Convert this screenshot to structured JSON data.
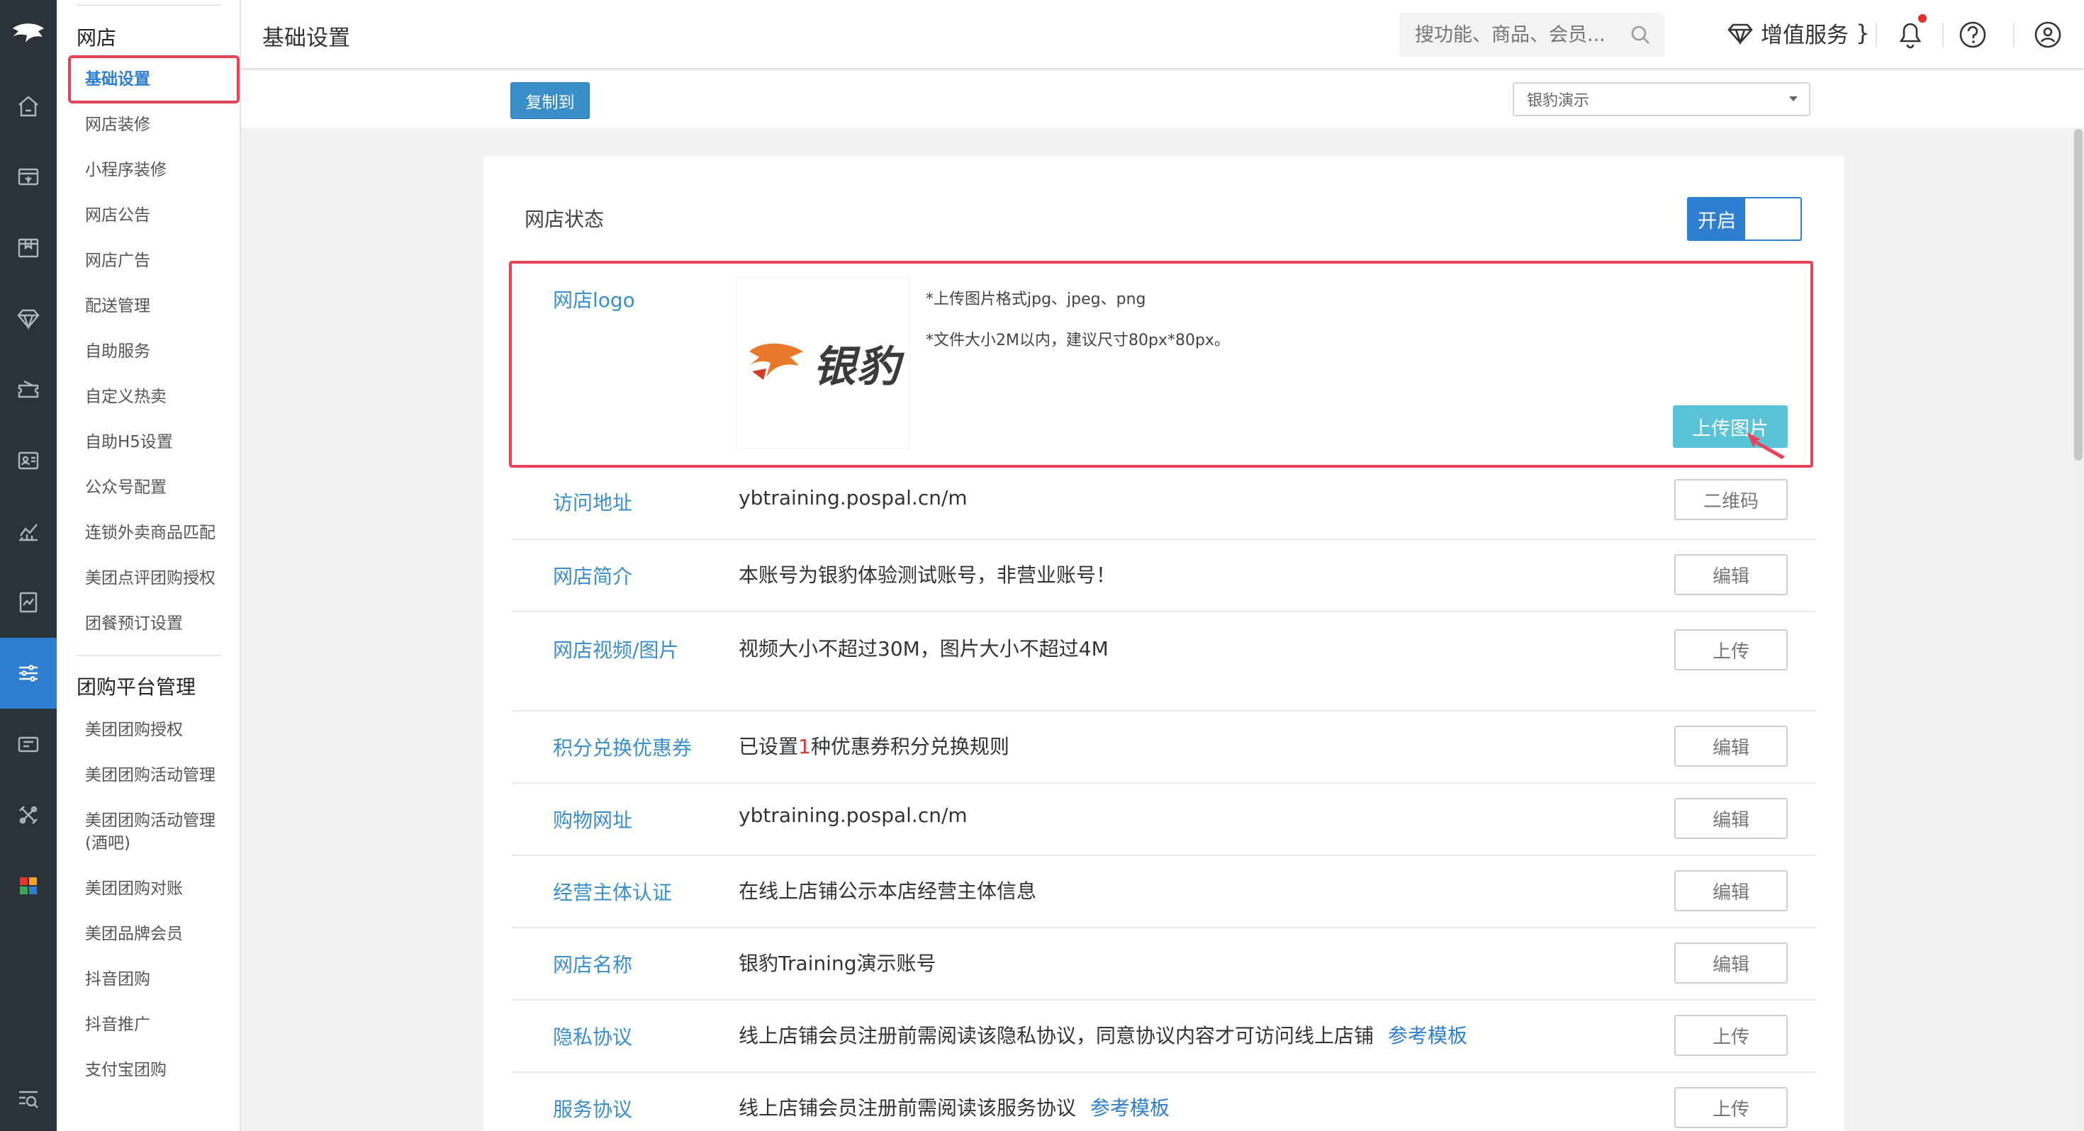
{
  "rail": {
    "logo_icon": "panther-logo-icon",
    "items": [
      {
        "icon": "home-icon"
      },
      {
        "icon": "cashier-icon"
      },
      {
        "icon": "box-icon"
      },
      {
        "icon": "diamond-icon"
      },
      {
        "icon": "ticket-icon"
      },
      {
        "icon": "member-card-icon"
      },
      {
        "icon": "chart-icon"
      },
      {
        "icon": "report-icon"
      },
      {
        "icon": "settings-sliders-icon",
        "active": true
      },
      {
        "icon": "coupon-icon"
      },
      {
        "icon": "tools-icon"
      },
      {
        "icon": "apps-grid-icon"
      },
      {
        "icon": "search-list-icon"
      }
    ]
  },
  "subnav": {
    "group1": "网店",
    "group1_items": [
      "基础设置",
      "网店装修",
      "小程序装修",
      "网店公告",
      "网店广告",
      "配送管理",
      "自助服务",
      "自定义热卖",
      "自助H5设置",
      "公众号配置",
      "连锁外卖商品匹配",
      "美团点评团购授权",
      "团餐预订设置"
    ],
    "group2": "团购平台管理",
    "group2_items": [
      "美团团购授权",
      "美团团购活动管理",
      "美团团购活动管理",
      "(酒吧)",
      "美团团购对账",
      "美团品牌会员",
      "抖音团购",
      "抖音推广",
      "支付宝团购"
    ]
  },
  "header": {
    "title": "基础设置",
    "search_placeholder": "搜功能、商品、会员...",
    "value_added": "增值服务"
  },
  "toolbar": {
    "copy_label": "复制到",
    "store_selected": "银豹演示"
  },
  "card": {
    "status_label": "网店状态",
    "toggle_on": "开启",
    "logo": {
      "label": "网店logo",
      "brand_text": "银豹",
      "hint1": "*上传图片格式jpg、jpeg、png",
      "hint2": "*文件大小2M以内，建议尺寸80px*80px。",
      "upload_label": "上传图片"
    },
    "rows": [
      {
        "label": "访问地址",
        "value": "ybtraining.pospal.cn/m",
        "button": "二维码"
      },
      {
        "label": "网店简介",
        "value": "本账号为银豹体验测试账号，非营业账号！",
        "button": "编辑"
      },
      {
        "label": "网店视频/图片",
        "value": "视频大小不超过30M，图片大小不超过4M",
        "button": "上传"
      },
      {
        "label": "积分兑换优惠券",
        "value_pre": "已设置",
        "value_num": "1",
        "value_post": "种优惠券积分兑换规则",
        "button": "编辑"
      },
      {
        "label": "购物网址",
        "value": "ybtraining.pospal.cn/m",
        "button": "编辑"
      },
      {
        "label": "经营主体认证",
        "value": "在线上店铺公示本店经营主体信息",
        "button": "编辑"
      },
      {
        "label": "网店名称",
        "value": "银豹Training演示账号",
        "button": "编辑"
      },
      {
        "label": "隐私协议",
        "value": "线上店铺会员注册前需阅读该隐私协议，同意协议内容才可访问线上店铺",
        "link": "参考模板",
        "button": "上传"
      },
      {
        "label": "服务协议",
        "value": "线上店铺会员注册前需阅读该服务协议",
        "link": "参考模板",
        "button": "上传"
      }
    ]
  }
}
